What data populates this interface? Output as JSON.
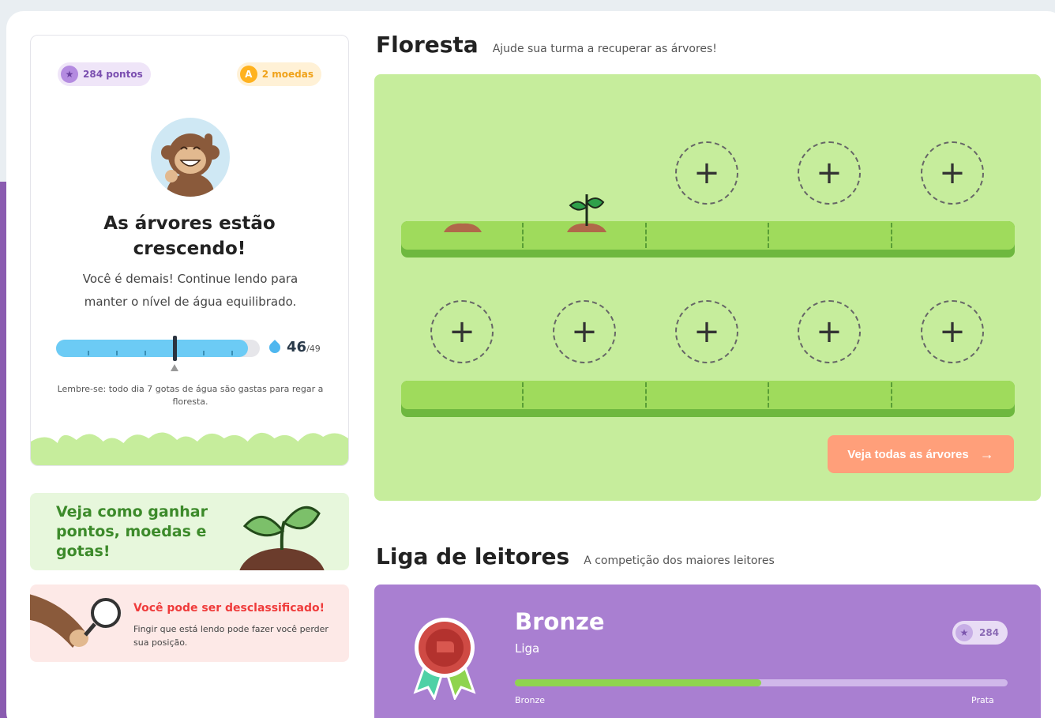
{
  "stats": {
    "points": "284 pontos",
    "coins": "2 moedas",
    "points_icon": "star-icon",
    "coins_icon": "coin-icon",
    "coin_letter": "A"
  },
  "profile": {
    "title_line1": "As árvores estão",
    "title_line2": "crescendo!",
    "message": "Você é demais! Continue lendo para manter o nível de água equilibrado.",
    "water_current": "46",
    "water_max": "/49",
    "water_fraction": 0.94,
    "water_marker_fraction": 0.58,
    "reminder": "Lembre-se: todo dia 7 gotas de água são gastas para regar a floresta."
  },
  "tip": {
    "text": "Veja como ganhar pontos, moedas e gotas!"
  },
  "warning": {
    "title": "Você pode ser desclassificado!",
    "description": "Fingir que está lendo pode fazer você perder sua posição."
  },
  "forest": {
    "title": "Floresta",
    "subtitle": "Ajude sua turma a recuperar as árvores!",
    "cta_label": "Veja todas as árvores",
    "cta_arrow": "→",
    "slot_symbol": "+",
    "row1": [
      "dirt",
      "sprout",
      "empty",
      "empty",
      "empty"
    ],
    "row2": [
      "empty",
      "empty",
      "empty",
      "empty",
      "empty"
    ]
  },
  "league": {
    "title": "Liga de leitores",
    "subtitle": "A competição dos maiores leitores",
    "name": "Bronze",
    "caption": "Liga",
    "score": "284",
    "progress_fraction": 0.5,
    "left_label": "Bronze",
    "right_label": "Prata",
    "colors": {
      "accent": "#a97fd1",
      "progress": "#8fd44f"
    }
  }
}
